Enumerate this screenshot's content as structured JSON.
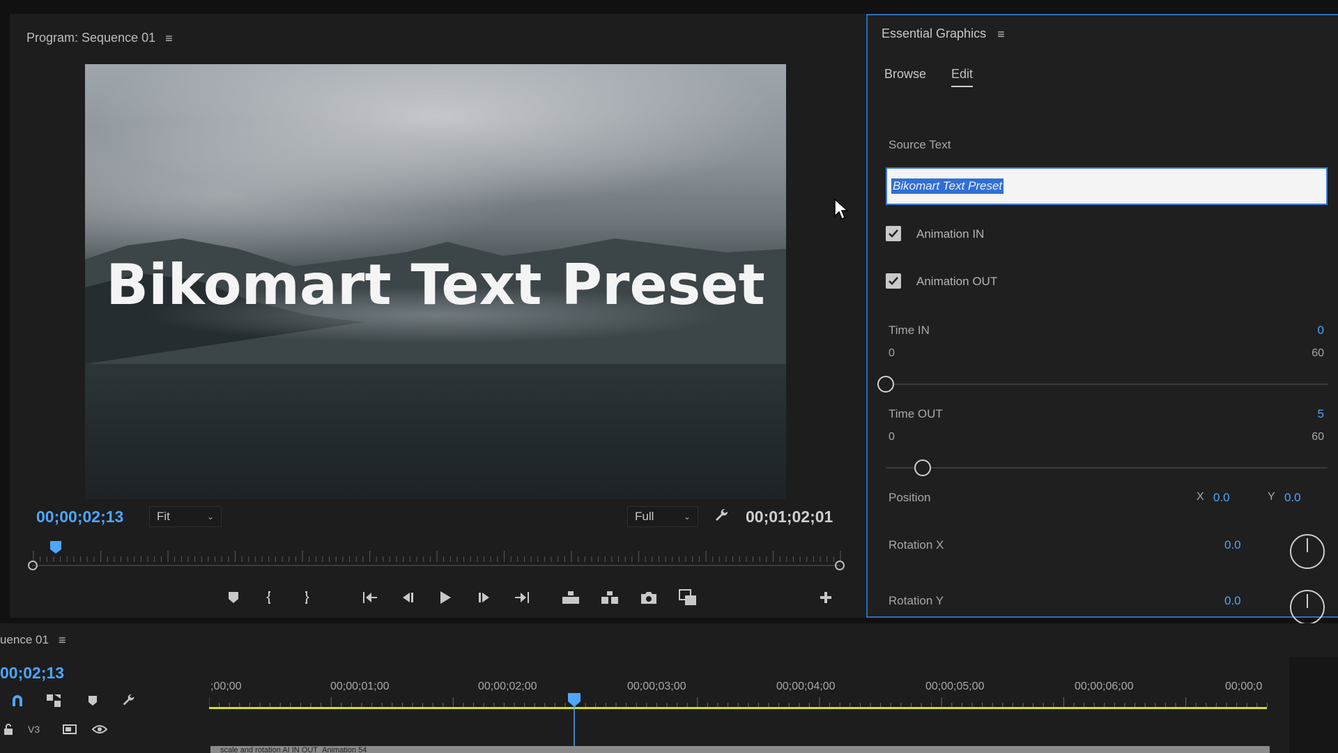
{
  "program_monitor": {
    "title": "Program: Sequence 01",
    "overlay_text": "Bikomart Text Preset",
    "current_timecode": "00;00;02;13",
    "zoom_select": "Fit",
    "resolution_select": "Full",
    "duration_timecode": "00;01;02;01"
  },
  "essential_graphics": {
    "title": "Essential Graphics",
    "tabs": {
      "browse": "Browse",
      "edit": "Edit"
    },
    "source_text_label": "Source Text",
    "source_text_value": "Bikomart Text Preset",
    "animation_in_label": "Animation IN",
    "animation_out_label": "Animation OUT",
    "time_in": {
      "label": "Time IN",
      "value": "0",
      "min": "0",
      "max": "60",
      "fraction": 0.0
    },
    "time_out": {
      "label": "Time OUT",
      "value": "5",
      "min": "0",
      "max": "60",
      "fraction": 0.083
    },
    "position": {
      "label": "Position",
      "x_label": "X",
      "x": "0.0",
      "y_label": "Y",
      "y": "0.0"
    },
    "rotation_x": {
      "label": "Rotation X",
      "value": "0.0"
    },
    "rotation_y": {
      "label": "Rotation Y",
      "value": "0.0"
    }
  },
  "timeline": {
    "title": "uence 01",
    "current_timecode": "00;02;13",
    "track_label": "V3",
    "ruler": [
      ";00;00",
      "00;00;01;00",
      "00;00;02;00",
      "00;00;03;00",
      "00;00;04;00",
      "00;00;05;00",
      "00;00;06;00",
      "00;00;0"
    ],
    "clip_label": "scale and rotation AI IN OUT_Animation 54"
  },
  "colors": {
    "accent": "#4ea6ff",
    "panel_border": "#2f6fb6",
    "work_area": "#d8e020"
  }
}
